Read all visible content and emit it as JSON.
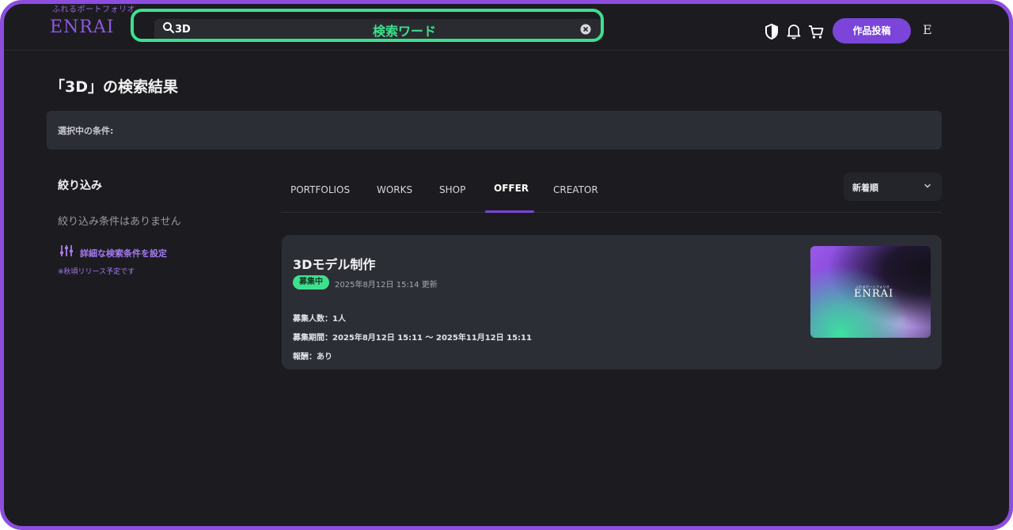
{
  "header": {
    "logo_tagline": "ふれるポートフォリオ",
    "logo_text": "ENRAI",
    "search_value": "3D",
    "search_annotation": "検索ワード",
    "post_button": "作品投稿",
    "avatar_initial": "E"
  },
  "page": {
    "title": "「3D」の検索結果",
    "conditions_label": "選択中の条件:"
  },
  "filter": {
    "heading": "絞り込み",
    "empty_text": "絞り込み条件はありません",
    "advanced_link": "詳細な検索条件を設定",
    "advanced_note": "※秋頃リリース予定です"
  },
  "tabs": [
    {
      "label": "PORTFOLIOS",
      "active": false
    },
    {
      "label": "WORKS",
      "active": false
    },
    {
      "label": "SHOP",
      "active": false
    },
    {
      "label": "OFFER",
      "active": true
    },
    {
      "label": "CREATOR",
      "active": false
    }
  ],
  "sort": {
    "selected": "新着順"
  },
  "results": [
    {
      "title": "3Dモデル制作",
      "status": "募集中",
      "updated": "2025年8月12日 15:14 更新",
      "recruit_count": "募集人数：1人",
      "recruit_period": "募集期間：2025年8月12日 15:11 〜 2025年11月12日 15:11",
      "reward": "報酬：あり",
      "thumbnail_tagline": "ふれるポートフォリオ",
      "thumbnail_logo": "ENRAI"
    }
  ],
  "colors": {
    "accent": "#7b45d9",
    "frame": "#8c4de0",
    "highlight": "#3ee08e",
    "background": "#1c1c20",
    "panel": "#2c2e35"
  }
}
